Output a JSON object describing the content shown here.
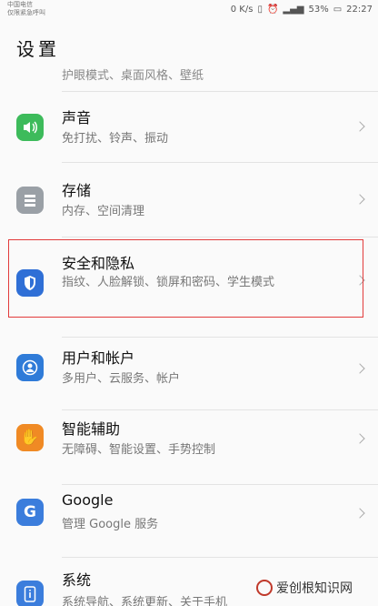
{
  "status_bar": {
    "carrier_line1": "中国电信",
    "carrier_line2": "仅限紧急呼叫",
    "net_speed": "0 K/s",
    "battery": "53%",
    "time": "22:27"
  },
  "header": {
    "title": "设置"
  },
  "partial_row": {
    "subtitle": "护眼模式、桌面风格、壁纸"
  },
  "rows": [
    {
      "title": "声音",
      "subtitle": "免打扰、铃声、振动",
      "icon": "speaker-icon",
      "color": "#3dbb5b"
    },
    {
      "title": "存储",
      "subtitle": "内存、空间清理",
      "icon": "storage-icon",
      "color": "#9aa0a6"
    },
    {
      "title": "安全和隐私",
      "subtitle": "指纹、人脸解锁、锁屏和密码、学生模式",
      "icon": "shield-icon",
      "color": "#2f6fd6"
    },
    {
      "title": "用户和帐户",
      "subtitle": "多用户、云服务、帐户",
      "icon": "user-icon",
      "color": "#2f7bd8"
    },
    {
      "title": "智能辅助",
      "subtitle": "无障碍、智能设置、手势控制",
      "icon": "hand-icon",
      "color": "#f08a24"
    },
    {
      "title": "Google",
      "subtitle": "管理 Google 服务",
      "icon": "google-icon",
      "color": "#3b7ddc"
    },
    {
      "title": "系统",
      "subtitle": "系统导航、系统更新、关于手机",
      "icon": "phone-info-icon",
      "color": "#3b7ddc"
    }
  ],
  "watermark": "爱创根知识网"
}
